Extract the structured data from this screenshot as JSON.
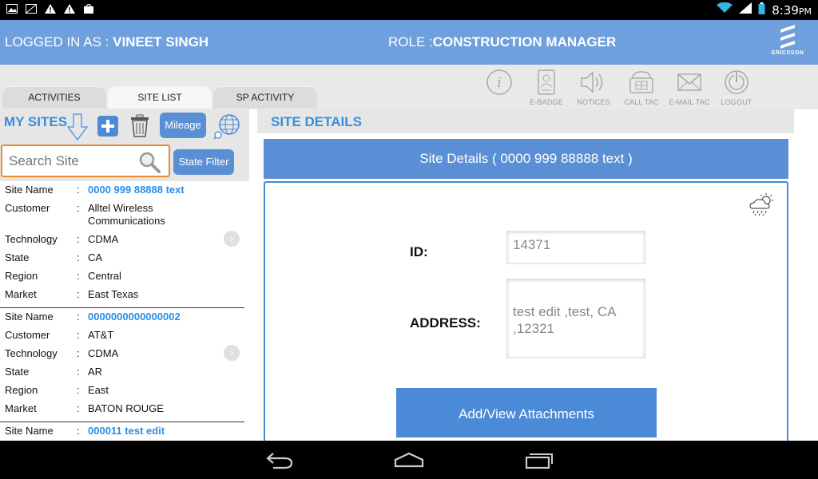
{
  "status_bar": {
    "time": "8:39",
    "time_suffix": "PM"
  },
  "header": {
    "login_prefix": "LOGGED IN AS :",
    "user_name": "VINEET SINGH",
    "role_prefix": "ROLE :",
    "role_name": "CONSTRUCTION MANAGER",
    "logo_text": "ERICSSON"
  },
  "tabs": [
    {
      "label": "ACTIVITIES"
    },
    {
      "label": "SITE LIST"
    },
    {
      "label": "SP ACTIVITY"
    }
  ],
  "tools": [
    {
      "label": ""
    },
    {
      "label": "E-BADGE"
    },
    {
      "label": "NOTICES"
    },
    {
      "label": "CALL TAC"
    },
    {
      "label": "E-MAIL TAC"
    },
    {
      "label": "LOGOUT"
    }
  ],
  "left": {
    "title": "MY SITES",
    "mileage_label": "Mileage",
    "search_placeholder": "Search Site",
    "state_filter_label": "State Filter",
    "field_labels": {
      "site_name": "Site Name",
      "customer": "Customer",
      "technology": "Technology",
      "state": "State",
      "region": "Region",
      "market": "Market",
      "colon": ":"
    },
    "sites": [
      {
        "site_name": "0000 999 88888 text",
        "customer": "Alltel Wireless Communications",
        "technology": "CDMA",
        "state": "CA",
        "region": "Central",
        "market": "East Texas"
      },
      {
        "site_name": "0000000000000002",
        "customer": "AT&T",
        "technology": "CDMA",
        "state": "AR",
        "region": "East",
        "market": "BATON ROUGE"
      },
      {
        "site_name": "000011 test edit"
      }
    ]
  },
  "right": {
    "section_title": "SITE DETAILS",
    "bar_title": "Site Details ( 0000 999 88888 text )",
    "id_label": "ID:",
    "id_value": "14371",
    "address_label": "ADDRESS:",
    "address_value": "test edit ,test, CA ,12321",
    "attach_label": "Add/View Attachments"
  }
}
